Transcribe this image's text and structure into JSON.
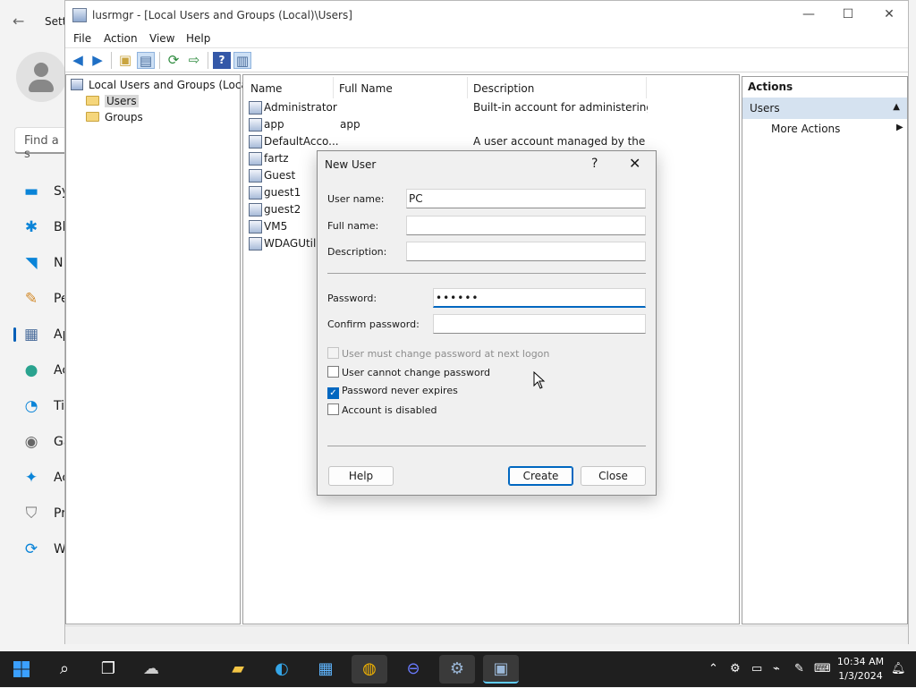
{
  "settings": {
    "title": "Sett",
    "search_placeholder": "Find a s",
    "nav": [
      {
        "label": "Sy",
        "icon": "system-icon"
      },
      {
        "label": "Bl",
        "icon": "bluetooth-icon"
      },
      {
        "label": "N",
        "icon": "network-icon"
      },
      {
        "label": "Pe",
        "icon": "personalization-icon"
      },
      {
        "label": "Ap",
        "icon": "apps-icon"
      },
      {
        "label": "Ac",
        "icon": "accounts-icon"
      },
      {
        "label": "Ti",
        "icon": "time-icon"
      },
      {
        "label": "Ga",
        "icon": "gaming-icon"
      },
      {
        "label": "Ac",
        "icon": "accessibility-icon"
      },
      {
        "label": "Pr",
        "icon": "privacy-icon"
      },
      {
        "label": "W",
        "icon": "windows-update-icon"
      }
    ]
  },
  "window": {
    "title": "lusrmgr - [Local Users and Groups (Local)\\Users]",
    "minimize": "—",
    "maximize": "☐",
    "close": "✕"
  },
  "menu": {
    "file": "File",
    "action": "Action",
    "view": "View",
    "help": "Help"
  },
  "tree": {
    "root": "Local Users and Groups (Local)",
    "items": [
      "Users",
      "Groups"
    ]
  },
  "list": {
    "columns": [
      "Name",
      "Full Name",
      "Description"
    ],
    "rows": [
      {
        "name": "Administrator",
        "full": "",
        "desc": "Built-in account for administering..."
      },
      {
        "name": "app",
        "full": "app",
        "desc": ""
      },
      {
        "name": "DefaultAcco...",
        "full": "",
        "desc": "A user account managed by the s..."
      },
      {
        "name": "fartz",
        "full": "",
        "desc": ""
      },
      {
        "name": "Guest",
        "full": "",
        "desc": ""
      },
      {
        "name": "guest1",
        "full": "",
        "desc": ""
      },
      {
        "name": "guest2",
        "full": "",
        "desc": ""
      },
      {
        "name": "VM5",
        "full": "",
        "desc": ""
      },
      {
        "name": "WDAGUtilit",
        "full": "",
        "desc": ""
      }
    ]
  },
  "actions": {
    "header": "Actions",
    "section": "Users",
    "more": "More Actions"
  },
  "dialog": {
    "title": "New User",
    "help_glyph": "?",
    "close_glyph": "✕",
    "username_label": "User name:",
    "username_value": "PC",
    "fullname_label": "Full name:",
    "fullname_value": "",
    "description_label": "Description:",
    "description_value": "",
    "password_label": "Password:",
    "password_value": "••••••",
    "confirm_label": "Confirm password:",
    "confirm_value": "",
    "options": [
      {
        "label": "User must change password at next logon",
        "checked": false,
        "disabled": true
      },
      {
        "label": "User cannot change password",
        "checked": false,
        "disabled": false
      },
      {
        "label": "Password never expires",
        "checked": true,
        "disabled": false
      },
      {
        "label": "Account is disabled",
        "checked": false,
        "disabled": false
      }
    ],
    "help_button": "Help",
    "create_button": "Create",
    "close_button": "Close"
  },
  "taskbar": {
    "apps": [
      "start-icon",
      "search-icon",
      "task-view-icon",
      "weather-icon",
      "file-explorer-icon",
      "edge-icon",
      "store-icon",
      "chrome-icon",
      "app-e-icon",
      "settings-icon",
      "lusrmgr-icon"
    ],
    "time": "10:34 AM",
    "date": "1/3/2024"
  },
  "colors": {
    "accent": "#0067c0",
    "selection": "#d5e2f0",
    "taskbar": "#1f1f1f"
  }
}
